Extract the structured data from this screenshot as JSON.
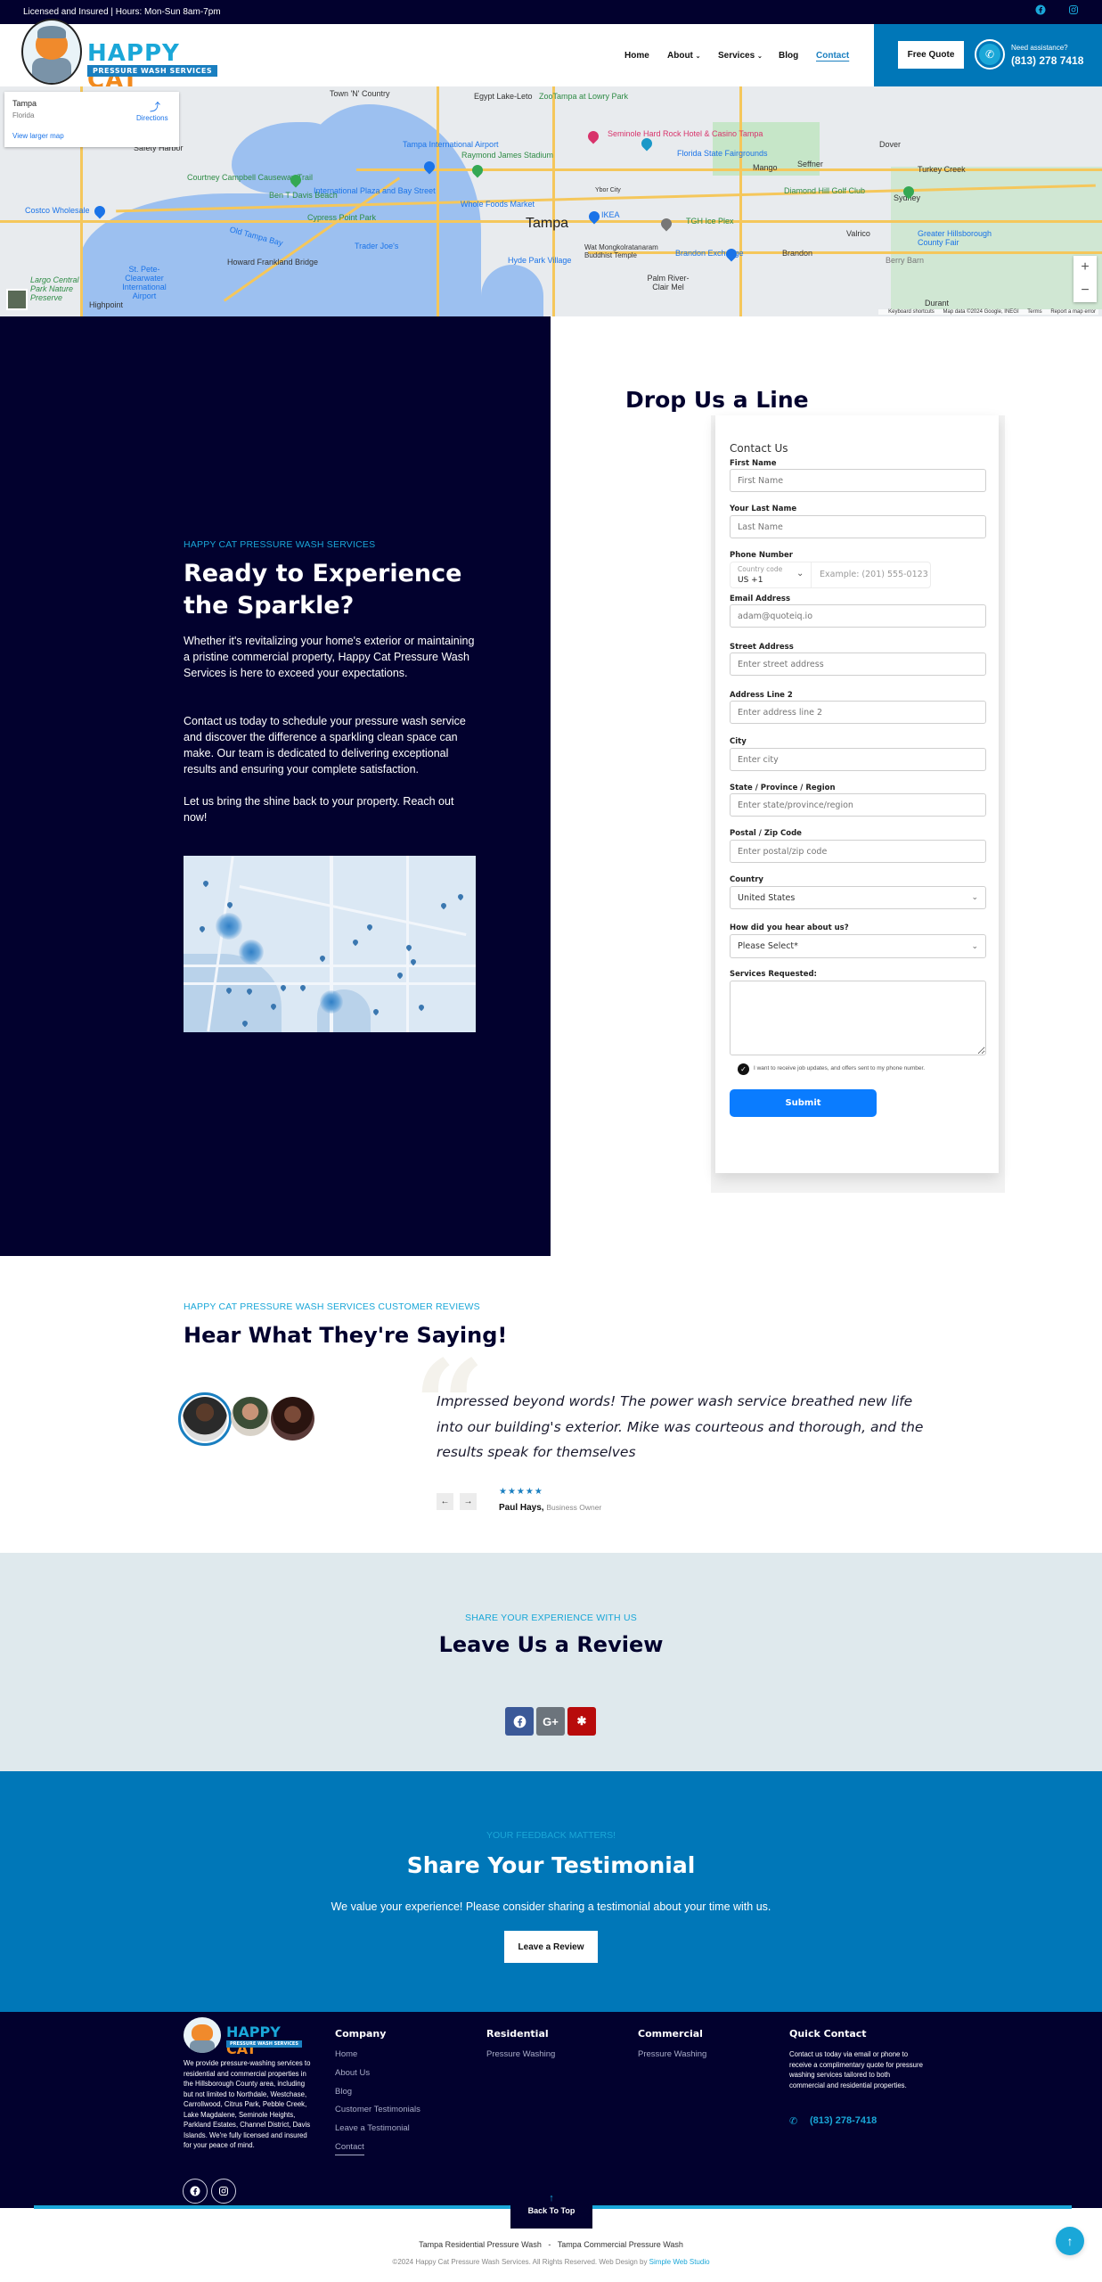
{
  "topbar": {
    "info": "Licensed and Insured | Hours: Mon-Sun 8am-7pm",
    "social": [
      "facebook-icon",
      "instagram-icon"
    ]
  },
  "header": {
    "brand_line1_a": "HAPPY",
    "brand_line1_b": "CAT",
    "brand_line2": "PRESSURE WASH SERVICES",
    "nav": [
      {
        "label": "Home"
      },
      {
        "label": "About",
        "dropdown": true
      },
      {
        "label": "Services",
        "dropdown": true
      },
      {
        "label": "Blog"
      },
      {
        "label": "Contact",
        "active": true
      }
    ],
    "cta_label": "Free Quote",
    "assist_label": "Need assistance?",
    "phone": "(813) 278 7418",
    "accent_color": "#0077b8"
  },
  "map": {
    "place_title": "Tampa",
    "place_subtitle": "Florida",
    "directions_label": "Directions",
    "view_larger_label": "View larger map",
    "city_label": "Tampa",
    "labels": [
      "Town 'N' Country",
      "Egypt Lake-Leto",
      "ZooTampa at Lowry Park",
      "Tampa International Airport",
      "Raymond James Stadium",
      "Seminole Hard Rock Hotel & Casino Tampa",
      "Florida State Fairgrounds",
      "Mango",
      "Seffner",
      "Dover",
      "Turkey Creek",
      "Sydney",
      "Diamond Hill Golf Club",
      "Safety Harbor",
      "Courtney Campbell Causeway Trail",
      "Ben T Davis Beach",
      "International Plaza and Bay Street",
      "Whole Foods Market",
      "Costco Wholesale",
      "Cypress Point Park",
      "Old Tampa Bay",
      "Howard Frankland Bridge",
      "Trader Joe's",
      "Hyde Park Village",
      "IKEA",
      "Ybor City",
      "Wat Mongkolratanaram Buddhist Temple",
      "TGH Ice Plex",
      "Brandon Exchange",
      "Brandon",
      "Valrico",
      "Greater Hillsborough County Fair",
      "Berry Barn",
      "Palm River-Clair Mel",
      "Highpoint",
      "Largo Central Park Nature Preserve",
      "St. Pete-Clearwater International Airport",
      "Durant"
    ],
    "footer_links": [
      "Keyboard shortcuts",
      "Map data ©2024 Google, INEGI",
      "Terms",
      "Report a map error"
    ]
  },
  "contact_intro": {
    "eyebrow": "HAPPY CAT PRESSURE WASH SERVICES",
    "title": "Ready to Experience the Sparkle?",
    "paragraphs": [
      "Whether it's revitalizing your home's exterior or maintaining a pristine commercial property, Happy Cat Pressure Wash Services is here to exceed your expectations.",
      "Contact us today to schedule your pressure wash service and discover the difference a sparkling clean space can make. Our team is dedicated to delivering exceptional results and ensuring your complete satisfaction.",
      "Let us bring the shine back to your property. Reach out now!"
    ]
  },
  "form": {
    "section_title": "Drop Us a Line",
    "card_title": "Contact Us",
    "fields": [
      {
        "label": "First Name",
        "placeholder": "First Name"
      },
      {
        "label": "Your Last Name",
        "placeholder": "Last Name"
      },
      {
        "label": "Phone Number",
        "country_code_label": "Country code",
        "country_code_value": "US  +1",
        "placeholder": "Example: (201) 555-0123"
      },
      {
        "label": "Email Address",
        "placeholder": "adam@quoteiq.io"
      },
      {
        "label": "Street Address",
        "placeholder": "Enter street address"
      },
      {
        "label": "Address Line 2",
        "placeholder": "Enter address line 2"
      },
      {
        "label": "City",
        "placeholder": "Enter city"
      },
      {
        "label": "State / Province / Region",
        "placeholder": "Enter state/province/region"
      },
      {
        "label": "Postal / Zip Code",
        "placeholder": "Enter postal/zip code"
      },
      {
        "label": "Country",
        "value": "United States"
      },
      {
        "label": "How did you hear about us?",
        "value": "Please Select*"
      },
      {
        "label": "Services Requested:",
        "value": ""
      }
    ],
    "consent_label": "I want to receive job updates, and offers sent to my phone number.",
    "consent_checked": true,
    "submit_label": "Submit",
    "submit_color": "#0a7cff"
  },
  "reviews": {
    "eyebrow": "HAPPY CAT PRESSURE WASH SERVICES CUSTOMER REVIEWS",
    "title": "Hear What They're Saying!",
    "quote": "Impressed beyond words! The power wash service breathed new life into our building's exterior. Mike was courteous and thorough, and the results speak for themselves",
    "rating": 5,
    "stars": "★★★★★",
    "author": "Paul Hays,",
    "author_role": "Business Owner",
    "prev_icon": "←",
    "next_icon": "→"
  },
  "leave_review": {
    "eyebrow": "SHARE YOUR EXPERIENCE WITH US",
    "title": "Leave Us a Review",
    "platforms": [
      {
        "name": "facebook",
        "glyph": "f",
        "color": "#3b5998"
      },
      {
        "name": "google-plus",
        "glyph": "G+",
        "color": "#6c747c"
      },
      {
        "name": "yelp",
        "glyph": "✱",
        "color": "#b80b0b"
      }
    ]
  },
  "testimonial": {
    "eyebrow": "YOUR FEEDBACK MATTERS!",
    "title": "Share Your Testimonial",
    "text": "We value your experience! Please consider sharing a testimonial about your time with us.",
    "button_label": "Leave a Review"
  },
  "footer": {
    "description": "We provide pressure-washing services to residential and commercial properties in the Hillsborough County area, including but not limited to Northdale, Westchase, Carrollwood, Citrus Park, Pebble Creek, Lake Magdalene, Seminole Heights, Parkland Estates, Channel District, Davis Islands. We're fully licensed and insured for your peace of mind.",
    "company_title": "Company",
    "company_links": [
      "Home",
      "About Us",
      "Blog",
      "Customer Testimonials",
      "Leave a Testimonial",
      "Contact"
    ],
    "residential_title": "Residential",
    "residential_links": [
      "Pressure Washing"
    ],
    "commercial_title": "Commercial",
    "commercial_links": [
      "Pressure Washing"
    ],
    "quick_title": "Quick Contact",
    "quick_text": "Contact us today via email or phone to receive a complimentary quote for pressure washing services tailored to both commercial and residential properties.",
    "quick_phone": "(813) 278-7418",
    "back_to_top": "Back To Top",
    "bottom_links": [
      "Tampa Residential Pressure Wash",
      "-",
      "Tampa Commercial Pressure Wash"
    ],
    "copyright": "©2024 Happy Cat Pressure Wash Services. All Rights Reserved. Web Design by ",
    "designer": "Simple Web Studio"
  }
}
